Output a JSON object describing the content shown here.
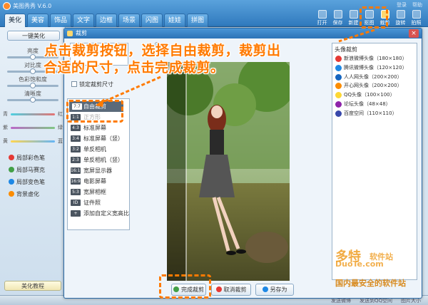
{
  "app": {
    "title": "美图秀秀 V.6.0"
  },
  "main_tabs": [
    "美化",
    "美容",
    "饰品",
    "文字",
    "边框",
    "场景",
    "闪图",
    "娃娃",
    "拼图"
  ],
  "top_links": [
    "登录",
    "帮助"
  ],
  "right_tools": [
    {
      "label": "打开",
      "active": false
    },
    {
      "label": "保存",
      "active": false
    },
    {
      "label": "新建",
      "active": false
    },
    {
      "label": "抠图",
      "active": false
    },
    {
      "label": "裁剪",
      "active": true
    },
    {
      "label": "旋转",
      "active": false
    },
    {
      "label": "拍照",
      "active": false
    }
  ],
  "left_panel": {
    "oneclick": "一键美化",
    "sliders": [
      "亮度",
      "对比度",
      "色彩饱和度",
      "清晰度"
    ],
    "colors": [
      {
        "left": "青",
        "right": "红",
        "color": "#e57373"
      },
      {
        "left": "紫",
        "right": "绿",
        "color": "#81c784"
      },
      {
        "left": "黄",
        "right": "蓝",
        "color": "#64b5f6"
      }
    ],
    "pens": [
      "局部彩色笔",
      "局部马赛克",
      "局部变色笔",
      "背景虚化"
    ],
    "beauty_btn": "美化教程"
  },
  "dialog": {
    "title": "裁剪",
    "lock_label": "锁定裁剪尺寸",
    "ratios": [
      {
        "badge": "7:7",
        "label": "自由裁剪",
        "selected": true
      },
      {
        "badge": "1:1",
        "label": "正方形",
        "dim": true
      },
      {
        "badge": "4:3",
        "label": "标准屏幕"
      },
      {
        "badge": "3:4",
        "label": "标准屏幕（竖）"
      },
      {
        "badge": "3:2",
        "label": "单反相机"
      },
      {
        "badge": "2:3",
        "label": "单反相机（竖）"
      },
      {
        "badge": "16:10",
        "label": "宽屏显示器"
      },
      {
        "badge": "16:9",
        "label": "电影屏幕"
      },
      {
        "badge": "5:3",
        "label": "宽屏相框"
      },
      {
        "badge": "ID",
        "label": "证件照"
      },
      {
        "badge": "+",
        "label": "添加自定义宽高比"
      }
    ],
    "popular": {
      "head": "头像裁剪",
      "items": [
        {
          "label": "新浪微博头像（180×180）",
          "color": "#e53935"
        },
        {
          "label": "腾讯微博头像（120×120）",
          "color": "#1e88e5"
        },
        {
          "label": "人人网头像（200×200）",
          "color": "#1565c0"
        },
        {
          "label": "开心网头像（200×200）",
          "color": "#fb8c00"
        },
        {
          "label": "QQ头像（100×100）",
          "color": "#fdd835"
        },
        {
          "label": "论坛头像（48×48）",
          "color": "#8e24aa"
        },
        {
          "label": "百度空间（110×110）",
          "color": "#3949ab"
        }
      ]
    },
    "buttons": {
      "done": "完成裁剪",
      "cancel": "取消裁剪",
      "saveas": "另存为"
    }
  },
  "instruction": {
    "line1": "点击裁剪按钮，选择自由裁剪，裁剪出",
    "line2": "合适的尺寸，点击完成裁剪。"
  },
  "watermark": {
    "brand": "多特",
    "brand_sub": "软件站",
    "site": "DuoTe.com",
    "slogan": "国内最安全的软件站"
  },
  "status": [
    "发送微博",
    "发送到QQ空间",
    "图片大小"
  ]
}
